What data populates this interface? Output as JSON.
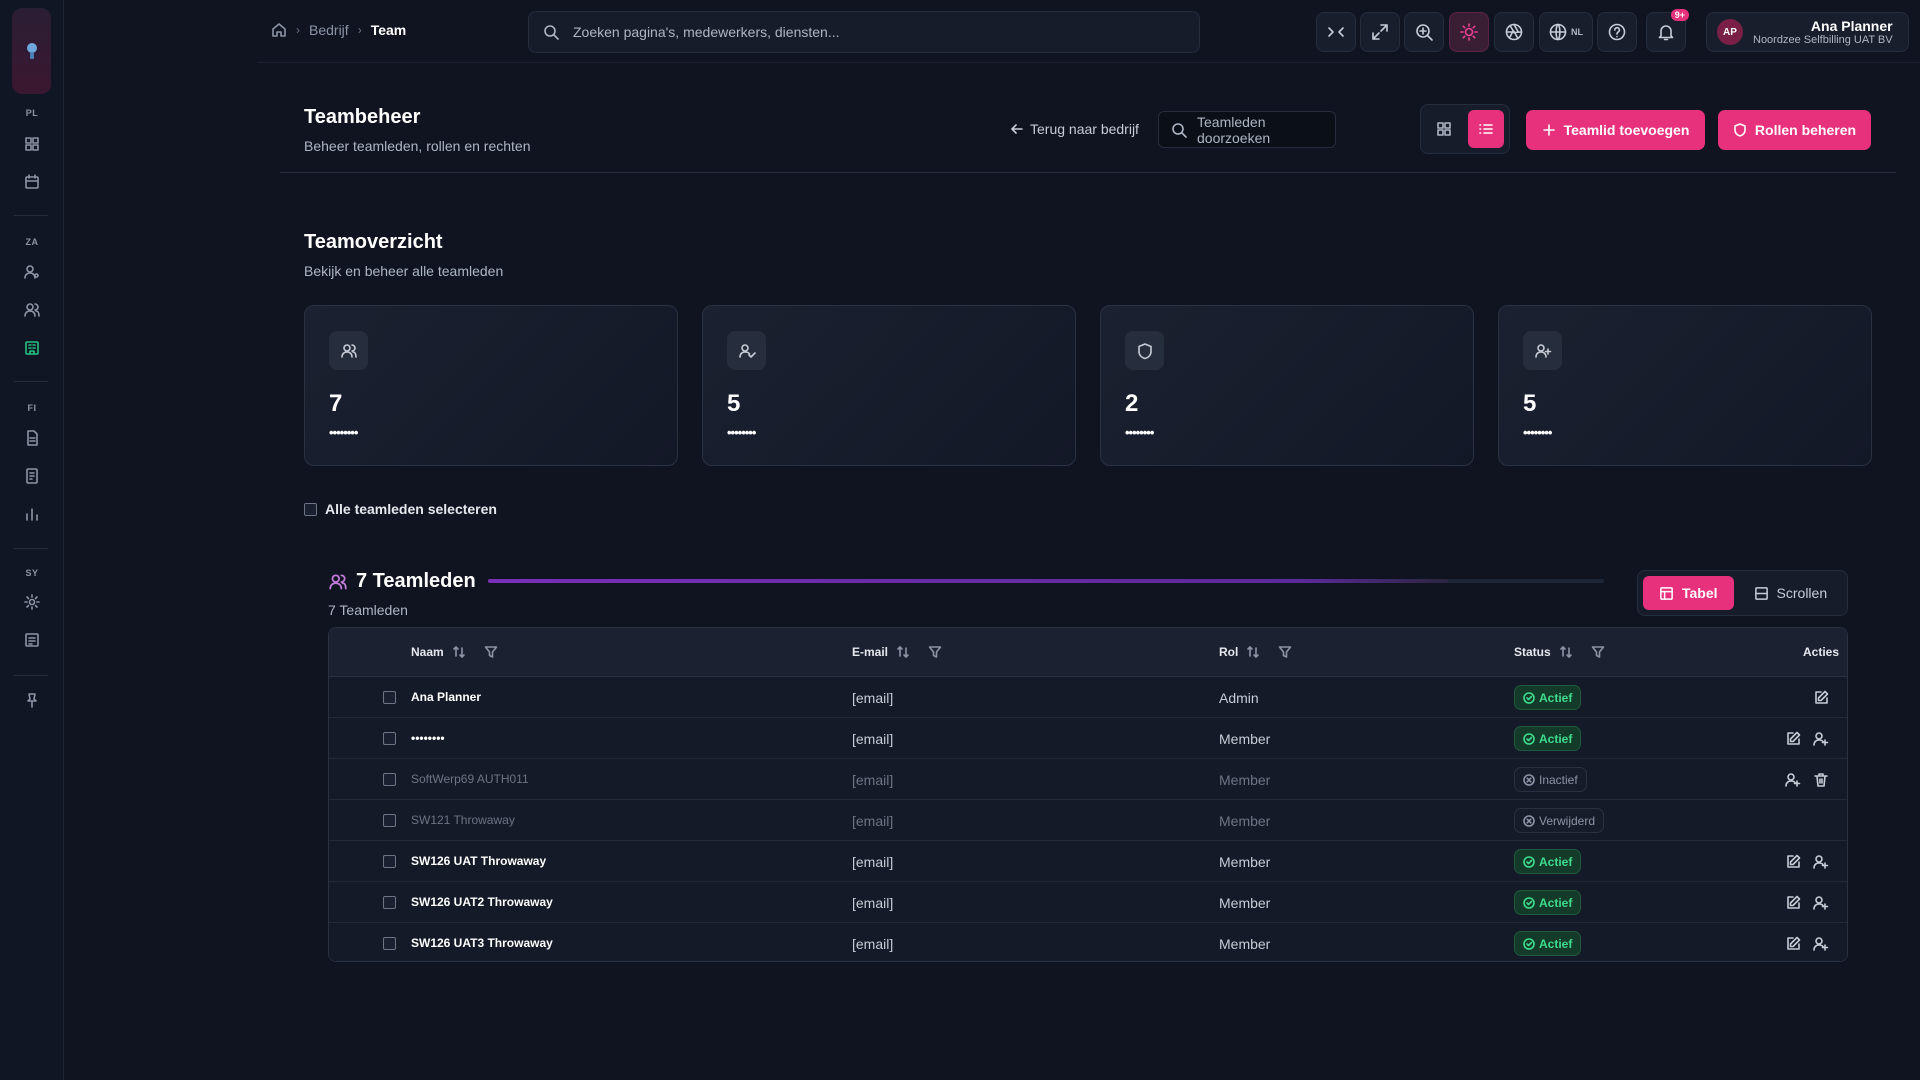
{
  "breadcrumb": {
    "items": [
      "Bedrijf",
      "Team"
    ]
  },
  "top_search": {
    "placeholder": "Zoeken pagina's, medewerkers, diensten..."
  },
  "topbar": {
    "language": "NL",
    "notifications_badge": "9+"
  },
  "user": {
    "initials": "AP",
    "name": "Ana Planner",
    "org": "Noordzee Selfbilling UAT BV"
  },
  "sidebar": {
    "sections": [
      "PL",
      "ZA",
      "FI",
      "SY"
    ]
  },
  "page": {
    "title": "Teambeheer",
    "subtitle": "Beheer teamleden, rollen en rechten",
    "back_label": "Terug naar bedrijf",
    "search_placeholder": "Teamleden doorzoeken",
    "add_label": "Teamlid toevoegen",
    "roles_label": "Rollen beheren"
  },
  "overview": {
    "title": "Teamoverzicht",
    "subtitle": "Bekijk en beheer alle teamleden",
    "stats": [
      {
        "icon": "users-icon",
        "value": "7",
        "label": "••••••••"
      },
      {
        "icon": "user-check-icon",
        "value": "5",
        "label": "••••••••"
      },
      {
        "icon": "shield-icon",
        "value": "2",
        "label": "••••••••"
      },
      {
        "icon": "user-plus-icon",
        "value": "5",
        "label": "••••••••"
      }
    ]
  },
  "select_all_label": "Alle teamleden selecteren",
  "list": {
    "title": "7 Teamleden",
    "count_label": "7 Teamleden",
    "progress": 0.86,
    "mode_table": "Tabel",
    "mode_scroll": "Scrollen",
    "columns": {
      "name": "Naam",
      "email": "E-mail",
      "role": "Rol",
      "status": "Status",
      "actions": "Acties"
    },
    "rows": [
      {
        "name": "Ana Planner",
        "email": "[email]",
        "role": "Admin",
        "status": "Actief",
        "dim": false,
        "actions": [
          "edit"
        ]
      },
      {
        "name": "••••••••",
        "email": "[email]",
        "role": "Member",
        "status": "Actief",
        "dim": false,
        "actions": [
          "edit",
          "user"
        ]
      },
      {
        "name": "SoftWerp69 AUTH011",
        "email": "[email]",
        "role": "Member",
        "status": "Inactief",
        "dim": true,
        "actions": [
          "user",
          "trash"
        ]
      },
      {
        "name": "SW121 Throwaway",
        "email": "[email]",
        "role": "Member",
        "status": "Verwijderd",
        "dim": true,
        "actions": []
      },
      {
        "name": "SW126 UAT Throwaway",
        "email": "[email]",
        "role": "Member",
        "status": "Actief",
        "dim": false,
        "actions": [
          "edit",
          "user"
        ]
      },
      {
        "name": "SW126 UAT2 Throwaway",
        "email": "[email]",
        "role": "Member",
        "status": "Actief",
        "dim": false,
        "actions": [
          "edit",
          "user"
        ]
      },
      {
        "name": "SW126 UAT3 Throwaway",
        "email": "[email]",
        "role": "Member",
        "status": "Actief",
        "dim": false,
        "actions": [
          "edit",
          "user"
        ]
      }
    ]
  },
  "colors": {
    "accent": "#e8317d",
    "active_green": "#3fdc8e",
    "list_bar": "#7a2fb8"
  }
}
